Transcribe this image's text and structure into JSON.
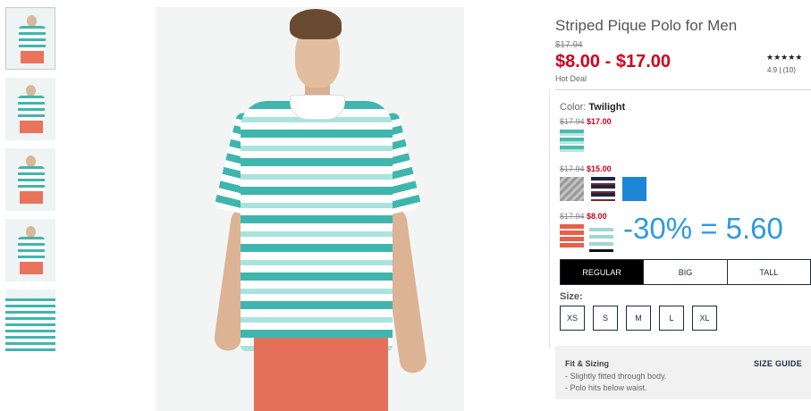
{
  "thumbnails": [
    {
      "name": "thumb-front-view",
      "active": true
    },
    {
      "name": "thumb-full-view"
    },
    {
      "name": "thumb-side-view"
    },
    {
      "name": "thumb-back-view"
    },
    {
      "name": "thumb-detail-view"
    }
  ],
  "product": {
    "title": "Striped Pique Polo for Men",
    "original_price": "$17.94",
    "sale_price": "$8.00 - $17.00",
    "deal_label": "Hot Deal",
    "stars": "★★★★★",
    "rating": "4.9 | (10)"
  },
  "color": {
    "label": "Color:",
    "selected": "Twilight",
    "tiers": [
      {
        "was": "$17.94",
        "now": "$17.00"
      },
      {
        "was": "$17.94",
        "now": "$15.00"
      },
      {
        "was": "$17.94",
        "now": "$8.00"
      }
    ]
  },
  "overlay_text": "-30% = 5.60",
  "fit_tabs": [
    "REGULAR",
    "BIG",
    "TALL"
  ],
  "size": {
    "label": "Size:",
    "options": [
      "XS",
      "S",
      "M",
      "L",
      "XL"
    ]
  },
  "fit_sizing": {
    "title": "Fit & Sizing",
    "guide_link": "SIZE GUIDE",
    "line1": "- Slightly fitted through body.",
    "line2": "- Polo hits below waist."
  },
  "colors": {
    "sale_red": "#d0021b",
    "navy": "#1f2a44",
    "overlay_blue": "#2b9be0"
  }
}
